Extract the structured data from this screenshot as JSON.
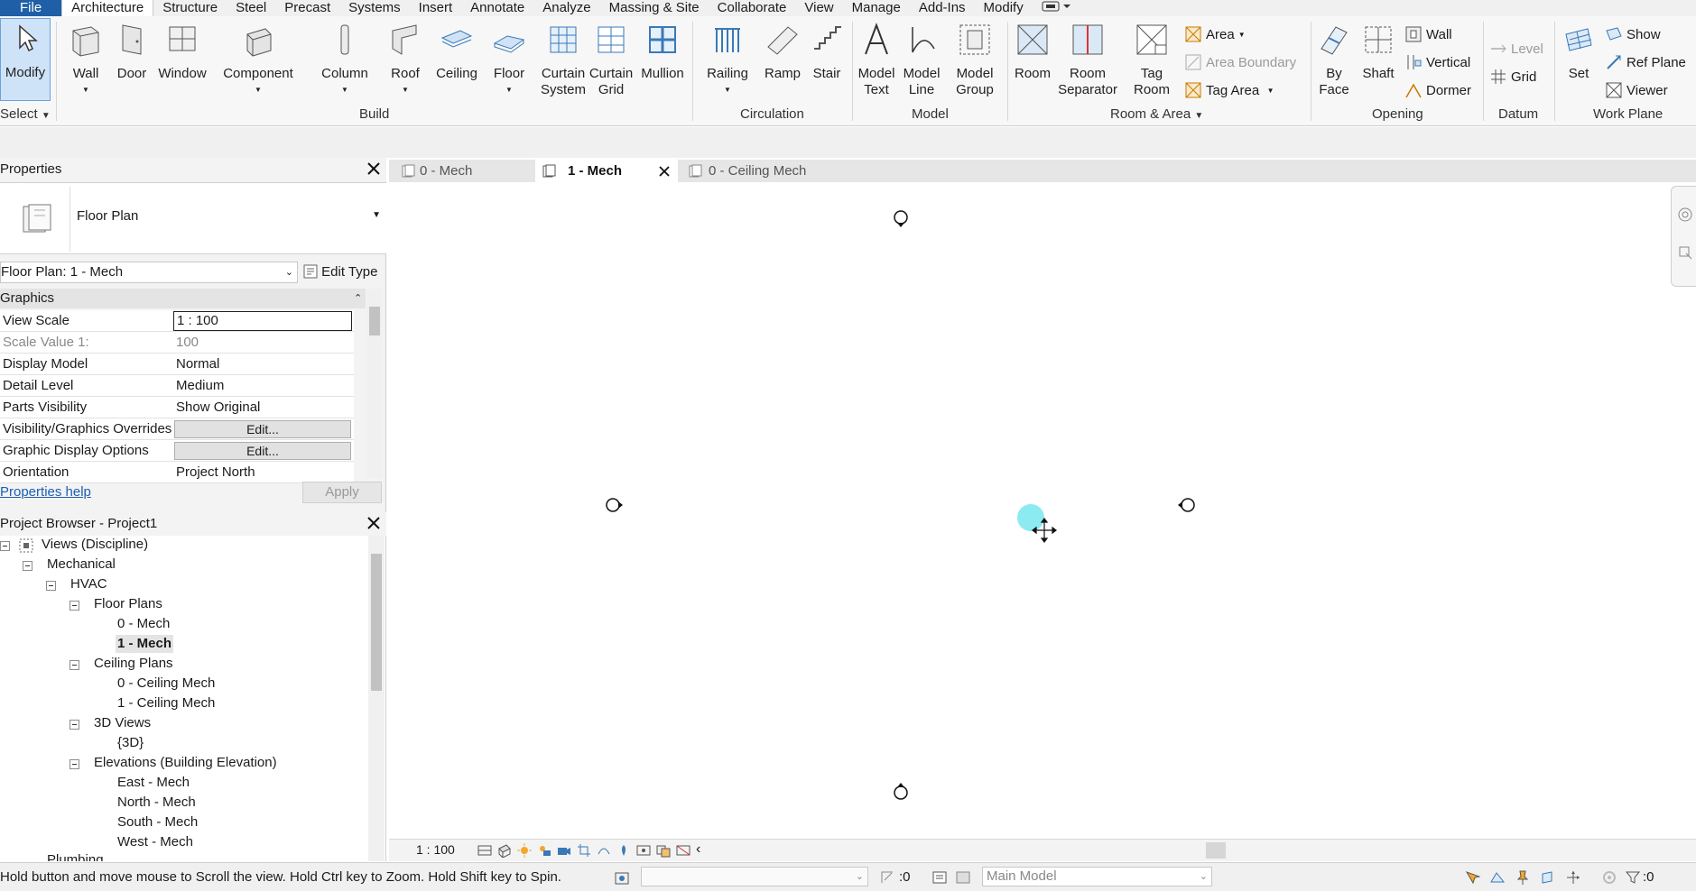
{
  "menubar": {
    "tabs": [
      "File",
      "Architecture",
      "Structure",
      "Steel",
      "Precast",
      "Systems",
      "Insert",
      "Annotate",
      "Analyze",
      "Massing & Site",
      "Collaborate",
      "View",
      "Manage",
      "Add-Ins",
      "Modify"
    ]
  },
  "ribbon": {
    "select": {
      "modify": "Modify",
      "group": "Select"
    },
    "build": {
      "group": "Build",
      "wall": "Wall",
      "door": "Door",
      "window": "Window",
      "component": "Component",
      "column": "Column",
      "roof": "Roof",
      "ceiling": "Ceiling",
      "floor": "Floor",
      "curtain_system_1": "Curtain",
      "curtain_system_2": "System",
      "curtain_grid_1": "Curtain",
      "curtain_grid_2": "Grid",
      "mullion": "Mullion"
    },
    "circulation": {
      "group": "Circulation",
      "railing": "Railing",
      "ramp": "Ramp",
      "stair": "Stair"
    },
    "model": {
      "group": "Model",
      "model_text_1": "Model",
      "model_text_2": "Text",
      "model_line_1": "Model",
      "model_line_2": "Line",
      "model_group_1": "Model",
      "model_group_2": "Group"
    },
    "room_area": {
      "group": "Room & Area",
      "room": "Room",
      "room_sep_1": "Room",
      "room_sep_2": "Separator",
      "tag_room_1": "Tag",
      "tag_room_2": "Room",
      "area": "Area",
      "area_boundary": "Area  Boundary",
      "tag_area": "Tag  Area"
    },
    "opening": {
      "group": "Opening",
      "by_face_1": "By",
      "by_face_2": "Face",
      "shaft": "Shaft",
      "wall": "Wall",
      "vertical": "Vertical",
      "dormer": "Dormer"
    },
    "datum": {
      "group": "Datum",
      "level": "Level",
      "grid": "Grid"
    },
    "work_plane": {
      "group": "Work Plane",
      "set": "Set",
      "show": "Show",
      "ref_plane": "Ref  Plane",
      "viewer": "Viewer"
    }
  },
  "properties": {
    "title": "Properties",
    "type_name": "Floor Plan",
    "selector": "Floor Plan: 1 - Mech",
    "edit_type": "Edit Type",
    "section": "Graphics",
    "rows": [
      {
        "name": "View Scale",
        "value": "1 : 100"
      },
      {
        "name": "Scale Value    1:",
        "value": "100"
      },
      {
        "name": "Display Model",
        "value": "Normal"
      },
      {
        "name": "Detail Level",
        "value": "Medium"
      },
      {
        "name": "Parts Visibility",
        "value": "Show Original"
      },
      {
        "name": "Visibility/Graphics Overrides",
        "value": "Edit..."
      },
      {
        "name": "Graphic Display Options",
        "value": "Edit..."
      },
      {
        "name": "Orientation",
        "value": "Project North"
      }
    ],
    "help": "Properties help",
    "apply": "Apply"
  },
  "browser": {
    "title": "Project Browser - Project1",
    "items": [
      "Views (Discipline)",
      "Mechanical",
      "HVAC",
      "Floor Plans",
      "0 - Mech",
      "1 - Mech",
      "Ceiling Plans",
      "0 - Ceiling Mech",
      "1 - Ceiling Mech",
      "3D Views",
      "{3D}",
      "Elevations (Building Elevation)",
      "East - Mech",
      "North - Mech",
      "South - Mech",
      "West - Mech",
      "Plumbing"
    ]
  },
  "tabs": [
    "0 - Mech",
    "1 - Mech",
    "0 - Ceiling Mech"
  ],
  "viewbar": {
    "scale": "1 : 100"
  },
  "status": {
    "message": "Hold button and move mouse to Scroll the view. Hold Ctrl key to Zoom. Hold Shift key to Spin.",
    "count": ":0",
    "model": "Main Model",
    "filter_count": ":0"
  },
  "colors": {
    "accent": "#1f5fa8",
    "cursor_highlight": "#7fe8f0"
  }
}
